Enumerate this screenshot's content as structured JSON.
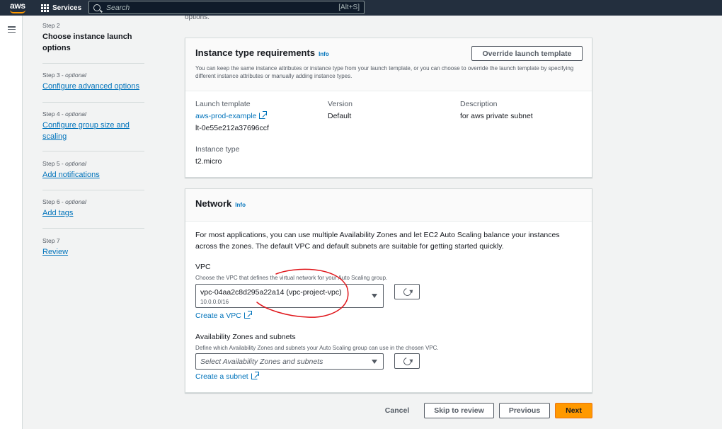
{
  "topbar": {
    "logo": "aws",
    "services_label": "Services",
    "search_placeholder": "Search",
    "search_shortcut": "[Alt+S]"
  },
  "steps": [
    {
      "label": "Step 2",
      "optional": "",
      "title": "Choose instance launch options",
      "current": true
    },
    {
      "label": "Step 3 - ",
      "optional": "optional",
      "title": "Configure advanced options",
      "current": false
    },
    {
      "label": "Step 4 - ",
      "optional": "optional",
      "title": "Configure group size and scaling",
      "current": false
    },
    {
      "label": "Step 5 - ",
      "optional": "optional",
      "title": "Add notifications",
      "current": false
    },
    {
      "label": "Step 6 - ",
      "optional": "optional",
      "title": "Add tags",
      "current": false
    },
    {
      "label": "Step 7",
      "optional": "",
      "title": "Review",
      "current": false
    }
  ],
  "cut_text": "options.",
  "instance_type": {
    "heading": "Instance type requirements",
    "info": "Info",
    "override_button": "Override launch template",
    "description": "You can keep the same instance attributes or instance type from your launch template, or you can choose to override the launch template by specifying different instance attributes or manually adding instance types.",
    "launch_template_label": "Launch template",
    "launch_template_link": "aws-prod-example",
    "launch_template_id": "lt-0e55e212a37696ccf",
    "version_label": "Version",
    "version_value": "Default",
    "description_label": "Description",
    "description_value": "for aws private subnet",
    "instance_type_label": "Instance type",
    "instance_type_value": "t2.micro"
  },
  "network": {
    "heading": "Network",
    "info": "Info",
    "intro": "For most applications, you can use multiple Availability Zones and let EC2 Auto Scaling balance your instances across the zones. The default VPC and default subnets are suitable for getting started quickly.",
    "vpc_label": "VPC",
    "vpc_hint": "Choose the VPC that defines the virtual network for your Auto Scaling group.",
    "vpc_value": "vpc-04aa2c8d295a22a14 (vpc-project-vpc)",
    "vpc_cidr": "10.0.0.0/16",
    "create_vpc": "Create a VPC",
    "az_label": "Availability Zones and subnets",
    "az_hint": "Define which Availability Zones and subnets your Auto Scaling group can use in the chosen VPC.",
    "az_placeholder": "Select Availability Zones and subnets",
    "create_subnet": "Create a subnet"
  },
  "footer": {
    "cancel": "Cancel",
    "skip": "Skip to review",
    "previous": "Previous",
    "next": "Next"
  },
  "colors": {
    "nav_bg": "#232f3e",
    "link": "#0073bb",
    "primary": "#ff9900",
    "annotation": "#e0161b"
  }
}
